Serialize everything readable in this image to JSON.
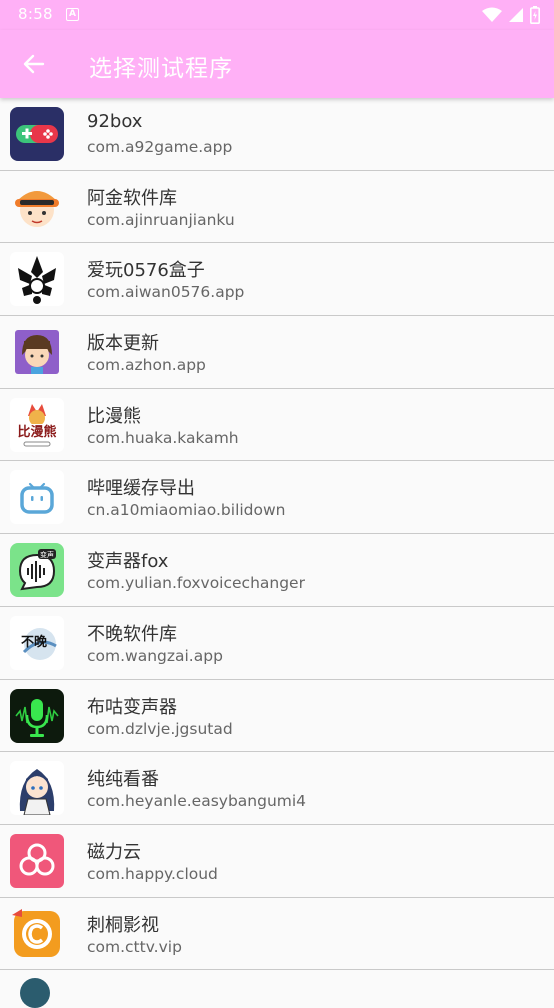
{
  "status": {
    "time": "8:58",
    "notif_letter": "A"
  },
  "appbar": {
    "title": "选择测试程序"
  },
  "apps": [
    {
      "name": "92box",
      "package": "com.a92game.app",
      "icon": "gamepad-icon"
    },
    {
      "name": "阿金软件库",
      "package": "com.ajinruanjianku",
      "icon": "cartoon-boy-icon"
    },
    {
      "name": "爱玩0576盒子",
      "package": "com.aiwan0576.app",
      "icon": "aiwan-logo-icon"
    },
    {
      "name": "版本更新",
      "package": "com.azhon.app",
      "icon": "cartoon-girl-icon"
    },
    {
      "name": "比漫熊",
      "package": "com.huaka.kakamh",
      "icon": "bimanxiong-logo-icon"
    },
    {
      "name": "哔哩缓存导出",
      "package": "cn.a10miaomiao.bilidown",
      "icon": "bilibili-tv-icon"
    },
    {
      "name": "变声器fox",
      "package": "com.yulian.foxvoicechanger",
      "icon": "voice-bubble-icon"
    },
    {
      "name": "不晚软件库",
      "package": "com.wangzai.app",
      "icon": "buwan-logo-icon"
    },
    {
      "name": "布咕变声器",
      "package": "com.dzlvje.jgsutad",
      "icon": "microphone-icon"
    },
    {
      "name": "纯纯看番",
      "package": "com.heyanle.easybangumi4",
      "icon": "anime-girl-icon"
    },
    {
      "name": "磁力云",
      "package": "com.happy.cloud",
      "icon": "cloud-rings-icon"
    },
    {
      "name": "刺桐影视",
      "package": "com.cttv.vip",
      "icon": "cttv-logo-icon"
    }
  ],
  "colors": {
    "appbar": "#ffb0f6",
    "text_primary": "#333333",
    "text_secondary": "#666666",
    "divider": "#c9c9c9"
  }
}
